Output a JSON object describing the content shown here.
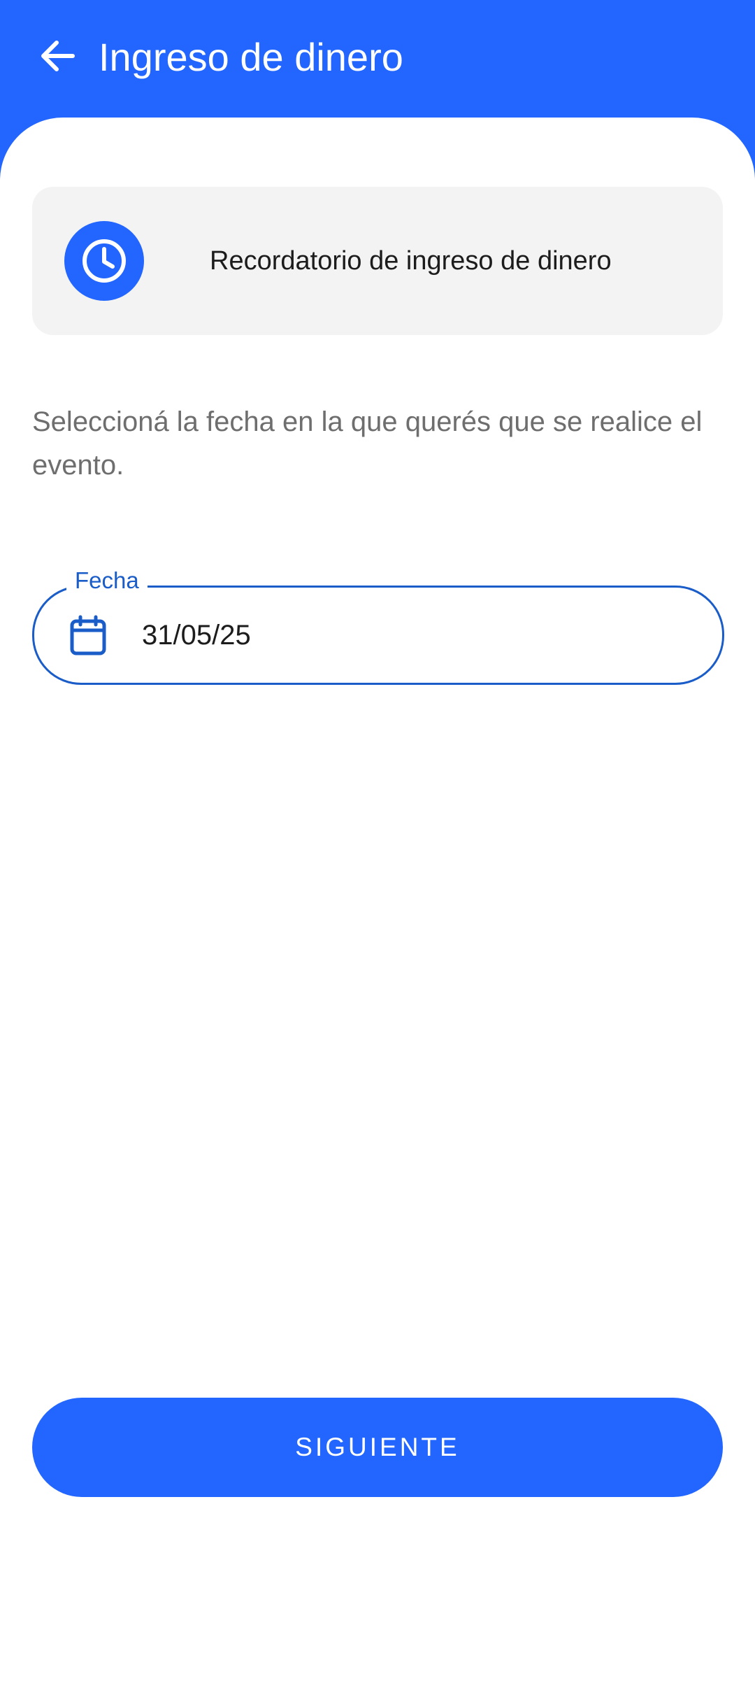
{
  "theme": {
    "primary": "#2266ff",
    "field_border": "#1a5cc8",
    "card_background": "#f3f3f3",
    "text_primary": "#1c1c1c",
    "text_secondary": "#6e6e6e"
  },
  "header": {
    "back_icon": "arrow-left-icon",
    "title": "Ingreso de dinero"
  },
  "reminder_card": {
    "icon": "clock-icon",
    "text": "Recordatorio de ingreso de dinero"
  },
  "instructions": {
    "text": "Seleccioná la fecha en la que querés que se realice el evento."
  },
  "date_field": {
    "label": "Fecha",
    "icon": "calendar-icon",
    "value": "31/05/25"
  },
  "footer": {
    "next_label": "SIGUIENTE"
  }
}
